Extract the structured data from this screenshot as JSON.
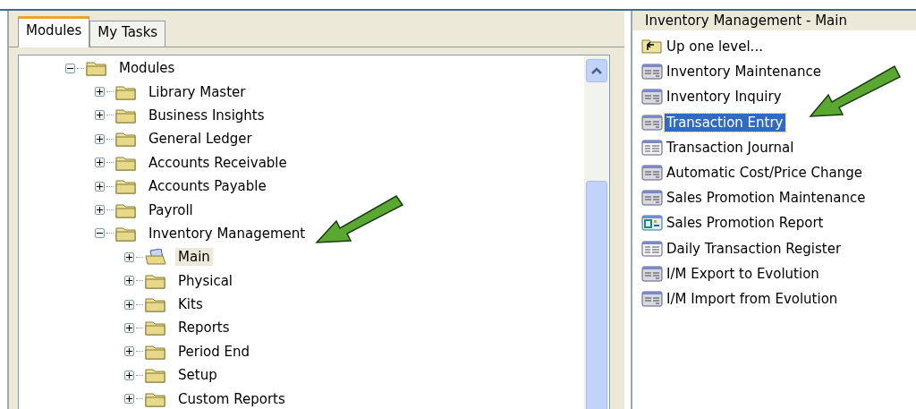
{
  "tabs": [
    {
      "label": "Modules",
      "selected": true
    },
    {
      "label": "My Tasks",
      "selected": false
    }
  ],
  "tree": [
    {
      "label": "Modules",
      "expanded": true,
      "selected": false,
      "children": [
        {
          "label": "Library Master",
          "expanded": false,
          "selected": false
        },
        {
          "label": "Business Insights",
          "expanded": false,
          "selected": false
        },
        {
          "label": "General Ledger",
          "expanded": false,
          "selected": false
        },
        {
          "label": "Accounts Receivable",
          "expanded": false,
          "selected": false
        },
        {
          "label": "Accounts Payable",
          "expanded": false,
          "selected": false
        },
        {
          "label": "Payroll",
          "expanded": false,
          "selected": false
        },
        {
          "label": "Inventory Management",
          "expanded": true,
          "selected": false,
          "children": [
            {
              "label": "Main",
              "expanded": false,
              "selected": true
            },
            {
              "label": "Physical",
              "expanded": false,
              "selected": false
            },
            {
              "label": "Kits",
              "expanded": false,
              "selected": false
            },
            {
              "label": "Reports",
              "expanded": false,
              "selected": false
            },
            {
              "label": "Period End",
              "expanded": false,
              "selected": false
            },
            {
              "label": "Setup",
              "expanded": false,
              "selected": false
            },
            {
              "label": "Custom Reports",
              "expanded": false,
              "selected": false
            }
          ]
        }
      ]
    }
  ],
  "task_panel": {
    "title": "Inventory Management - Main",
    "items": [
      {
        "label": "Up one level...",
        "kind": "up",
        "selected": false
      },
      {
        "label": "Inventory Maintenance",
        "kind": "form",
        "selected": false
      },
      {
        "label": "Inventory Inquiry",
        "kind": "form",
        "selected": false
      },
      {
        "label": "Transaction Entry",
        "kind": "form",
        "selected": true
      },
      {
        "label": "Transaction Journal",
        "kind": "report",
        "selected": false
      },
      {
        "label": "Automatic Cost/Price Change",
        "kind": "form",
        "selected": false
      },
      {
        "label": "Sales Promotion Maintenance",
        "kind": "form",
        "selected": false
      },
      {
        "label": "Sales Promotion Report",
        "kind": "promo",
        "selected": false
      },
      {
        "label": "Daily Transaction Register",
        "kind": "report",
        "selected": false
      },
      {
        "label": "I/M Export to Evolution",
        "kind": "form",
        "selected": false
      },
      {
        "label": "I/M Import from Evolution",
        "kind": "form",
        "selected": false
      }
    ]
  }
}
